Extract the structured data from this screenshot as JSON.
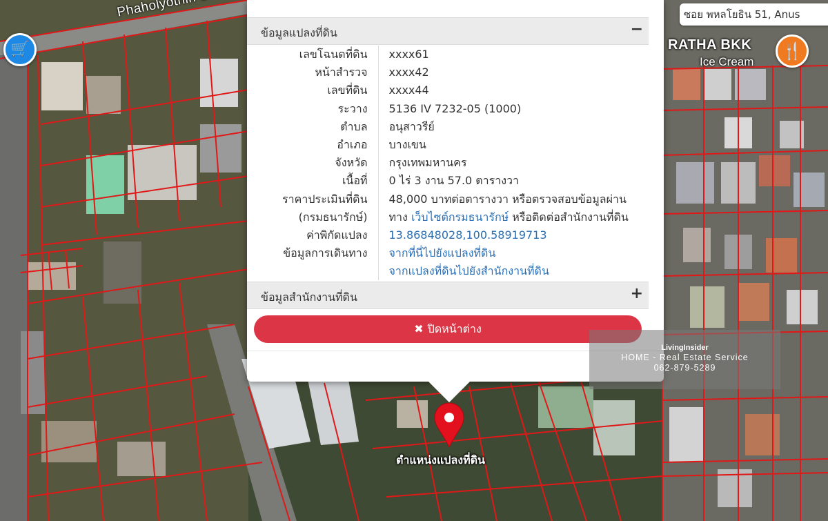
{
  "map": {
    "road_name": "Phaholyothin S",
    "street_tag": "ซอย พหลโยธิน 51, Anus",
    "poi_name": "RATHA BKK",
    "poi_subtitle": "Ice Cream",
    "poi_food_icon": "fork-knife-icon",
    "poi_shop_icon": "shopping-cart-icon",
    "pin_label": "ตำแหน่งแปลงที่ดิน",
    "pin_color": "#e3101e",
    "parcel_line_color": "#e01818"
  },
  "popup": {
    "land_section": {
      "title": "ข้อมูลแปลงที่ดิน",
      "toggle": "−",
      "rows": [
        {
          "label": "เลขโฉนดที่ดิน",
          "value": "xxxx61"
        },
        {
          "label": "หน้าสำรวจ",
          "value": "xxxx42"
        },
        {
          "label": "เลขที่ดิน",
          "value": "xxxx44"
        },
        {
          "label": "ระวาง",
          "value": "5136 IV 7232-05 (1000)"
        },
        {
          "label": "ตำบล",
          "value": "อนุสาวรีย์"
        },
        {
          "label": "อำเภอ",
          "value": "บางเขน"
        },
        {
          "label": "จังหวัด",
          "value": "กรุงเทพมหานคร"
        },
        {
          "label": "เนื้อที่",
          "value": "0 ไร่ 3 งาน 57.0 ตารางวา"
        }
      ],
      "price": {
        "label1": "ราคาประเมินที่ดิน",
        "label2": "(กรมธนารักษ์)",
        "value1": "48,000 บาทต่อตารางวา หรือตรวจสอบข้อมูลผ่าน",
        "value2_prefix": "ทาง ",
        "value2_link": "เว็บไซต์กรมธนารักษ์",
        "value2_suffix": " หรือติดต่อสำนักงานที่ดิน"
      },
      "coords": {
        "label": "ค่าพิกัดแปลง",
        "value": "13.86848028,100.58919713"
      },
      "travel": {
        "label": "ข้อมูลการเดินทาง",
        "link1": "จากที่นี่ไปยังแปลงที่ดิน",
        "link2": "จากแปลงที่ดินไปยังสำนักงานที่ดิน"
      }
    },
    "office_section": {
      "title": "ข้อมูลสำนักงานที่ดิน",
      "toggle": "+"
    },
    "close_button": {
      "icon": "✖",
      "label": "ปิดหน้าต่าง"
    }
  },
  "watermark": {
    "brand": "LivingInsider",
    "line1": "HOME - Real Estate Service",
    "line2": "062-879-5289"
  }
}
